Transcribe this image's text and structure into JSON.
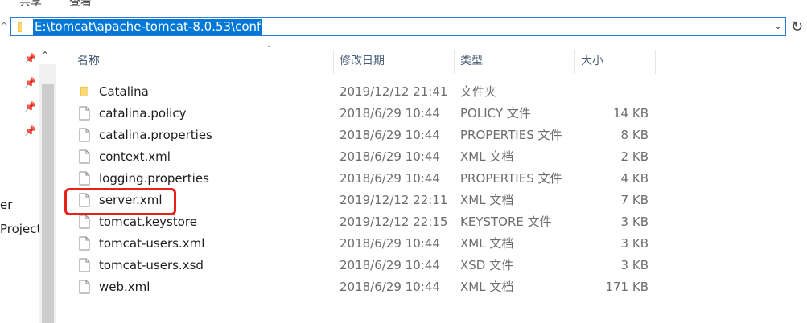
{
  "top_fragments": [
    "共享",
    "查看"
  ],
  "address": {
    "path": "E:\\tomcat\\apache-tomcat-8.0.53\\conf"
  },
  "nav": {
    "items": [
      "er",
      "Project"
    ]
  },
  "columns": {
    "name": "名称",
    "date": "修改日期",
    "type": "类型",
    "size": "大小"
  },
  "files": [
    {
      "name": "Catalina",
      "date": "2019/12/12 21:41",
      "type": "文件夹",
      "size": "",
      "kind": "folder"
    },
    {
      "name": "catalina.policy",
      "date": "2018/6/29 10:44",
      "type": "POLICY 文件",
      "size": "14 KB",
      "kind": "file"
    },
    {
      "name": "catalina.properties",
      "date": "2018/6/29 10:44",
      "type": "PROPERTIES 文件",
      "size": "8 KB",
      "kind": "file"
    },
    {
      "name": "context.xml",
      "date": "2018/6/29 10:44",
      "type": "XML 文档",
      "size": "2 KB",
      "kind": "file"
    },
    {
      "name": "logging.properties",
      "date": "2018/6/29 10:44",
      "type": "PROPERTIES 文件",
      "size": "4 KB",
      "kind": "file"
    },
    {
      "name": "server.xml",
      "date": "2019/12/12 22:11",
      "type": "XML 文档",
      "size": "7 KB",
      "kind": "file"
    },
    {
      "name": "tomcat.keystore",
      "date": "2019/12/12 22:15",
      "type": "KEYSTORE 文件",
      "size": "3 KB",
      "kind": "file"
    },
    {
      "name": "tomcat-users.xml",
      "date": "2018/6/29 10:44",
      "type": "XML 文档",
      "size": "3 KB",
      "kind": "file"
    },
    {
      "name": "tomcat-users.xsd",
      "date": "2018/6/29 10:44",
      "type": "XSD 文件",
      "size": "3 KB",
      "kind": "file"
    },
    {
      "name": "web.xml",
      "date": "2018/6/29 10:44",
      "type": "XML 文档",
      "size": "171 KB",
      "kind": "file"
    }
  ],
  "colors": {
    "selection": "#0078d7",
    "highlight_box": "#e8221b",
    "folder": "#f5c342"
  }
}
